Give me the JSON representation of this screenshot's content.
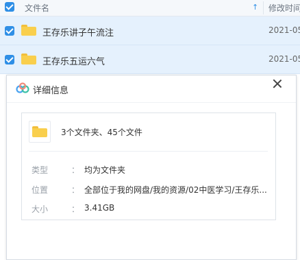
{
  "file_list": {
    "header": {
      "name_label": "文件名",
      "sort_icon": "arrow-up-icon",
      "date_label": "修改时间"
    },
    "rows": [
      {
        "name": "王存乐讲子午流注",
        "date": "2021-05"
      },
      {
        "name": "王存乐五运六气",
        "date": "2021-05"
      }
    ]
  },
  "dialog": {
    "title": "详细信息",
    "summary": "3个文件夹、45个文件",
    "fields": [
      {
        "label": "类型",
        "colon": "：",
        "value": "均为文件夹"
      },
      {
        "label": "位置",
        "colon": "：",
        "value": "全部位于我的网盘/我的资源/02中医学习/王存乐..."
      },
      {
        "label": "大小",
        "colon": "：",
        "value": "3.41GB"
      }
    ]
  },
  "colors": {
    "accent": "#2f8fe6",
    "selected_row": "#e5f1fd",
    "folder": "#f9cf4d"
  }
}
